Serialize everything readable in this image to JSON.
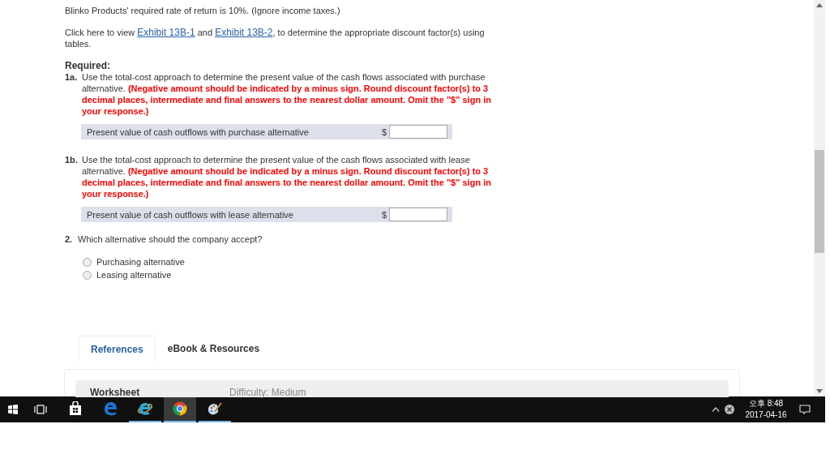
{
  "intro": "Blinko Products' required rate of return is 10%. (Ignore income taxes.)",
  "exhibits": {
    "before": "Click here to view",
    "links": [
      "Exhibit 13B-1",
      "Exhibit 13B-2"
    ],
    "joiner": "and",
    "after": ", to determine the appropriate discount factor(s) using tables."
  },
  "required_label": "Required:",
  "parts": [
    {
      "number": "1a.",
      "text": "Use the total-cost approach to determine the present value of the cash flows associated with purchase alternative.",
      "note": "(Negative amount should be indicated by a minus sign. Round discount factor(s) to 3 decimal places, intermediate and final answers to the nearest dollar amount. Omit the \"$\" sign in your response.)",
      "answer_label": "Present value of cash outflows with purchase alternative",
      "currency": "$"
    },
    {
      "number": "1b.",
      "text": "Use the total-cost approach to determine the present value of the cash flows associated with lease alternative.",
      "note": "(Negative amount should be indicated by a minus sign. Round discount factor(s) to 3 decimal places, intermediate and final answers to the nearest dollar amount. Omit the \"$\" sign in your response.)",
      "answer_label": "Present value of cash outflows with lease alternative",
      "currency": "$"
    }
  ],
  "question2": {
    "number": "2.",
    "text": "Which alternative should the company accept?",
    "options": [
      {
        "label": "Purchasing alternative",
        "selected": false
      },
      {
        "label": "Leasing alternative",
        "selected": false
      }
    ]
  },
  "tabs": [
    {
      "label": "References",
      "selected": true
    },
    {
      "label": "eBook & Resources",
      "selected": false
    }
  ],
  "worksheet": {
    "title": "Worksheet",
    "difficulty": "Difficulty: Medium"
  },
  "taskbar": {
    "apps": [
      {
        "kind": "store",
        "running": false,
        "selected": false
      },
      {
        "kind": "edge",
        "running": false,
        "selected": false
      },
      {
        "kind": "ie",
        "running": true,
        "selected": false
      },
      {
        "kind": "chrome",
        "running": true,
        "selected": true
      },
      {
        "kind": "paint",
        "running": true,
        "selected": false
      }
    ],
    "time": "오후 8:48",
    "date": "2017-04-16"
  }
}
